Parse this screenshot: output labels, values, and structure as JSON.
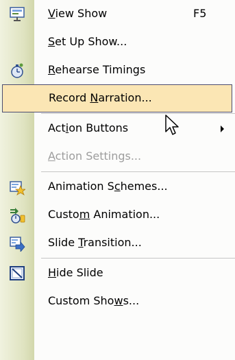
{
  "menu": {
    "items": [
      {
        "label": "View Show",
        "mnemonic_index": 0,
        "shortcut": "F5",
        "icon": "slide-show-icon"
      },
      {
        "label": "Set Up Show...",
        "mnemonic_index": 0
      },
      {
        "label": "Rehearse Timings",
        "mnemonic_index": 0,
        "icon": "stopwatch-icon"
      },
      {
        "label": "Record Narration...",
        "mnemonic_index": 7,
        "highlighted": true
      },
      {
        "label": "Action Buttons",
        "mnemonic_index": 3,
        "submenu": true
      },
      {
        "label": "Action Settings...",
        "mnemonic_index": 0,
        "disabled": true
      },
      {
        "label": "Animation Schemes...",
        "mnemonic_index": 11,
        "icon": "animation-schemes-icon"
      },
      {
        "label": "Custom Animation...",
        "mnemonic_index": 5,
        "icon": "custom-animation-icon"
      },
      {
        "label": "Slide Transition...",
        "mnemonic_index": 6,
        "icon": "slide-transition-icon"
      },
      {
        "label": "Hide Slide",
        "mnemonic_index": 0,
        "icon": "hide-slide-icon"
      },
      {
        "label": "Custom Shows...",
        "mnemonic_index": 10
      }
    ]
  },
  "colors": {
    "highlight_bg": "#fbe6b4",
    "highlight_border": "#4b4b6f",
    "disabled_text": "#9d9d9d"
  }
}
